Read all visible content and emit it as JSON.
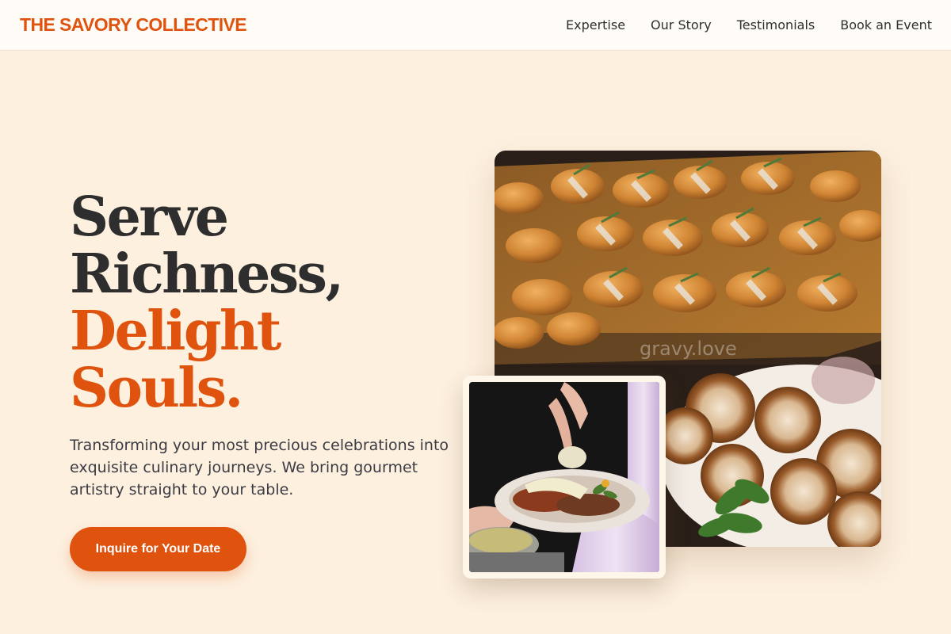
{
  "brand": "THE SAVORY COLLECTIVE",
  "nav": {
    "items": [
      {
        "label": "Expertise"
      },
      {
        "label": "Our Story"
      },
      {
        "label": "Testimonials"
      },
      {
        "label": "Book an Event"
      }
    ]
  },
  "hero": {
    "headline_line1": "Serve",
    "headline_line2": "Richness,",
    "headline_line3": "Delight Souls.",
    "subtitle": "Transforming your most precious celebrations into exquisite culinary journeys. We bring gourmet artistry straight to your table.",
    "cta_label": "Inquire for Your Date"
  },
  "images": {
    "main_watermark": "gravy.love",
    "main_image_icon": "croissant-platter-photo",
    "inset_image_icon": "plated-dish-serving-photo"
  },
  "colors": {
    "accent": "#e0530f",
    "background": "#fdf0df",
    "nav_background": "#fffcf7",
    "text_dark": "#2e2e2e"
  }
}
